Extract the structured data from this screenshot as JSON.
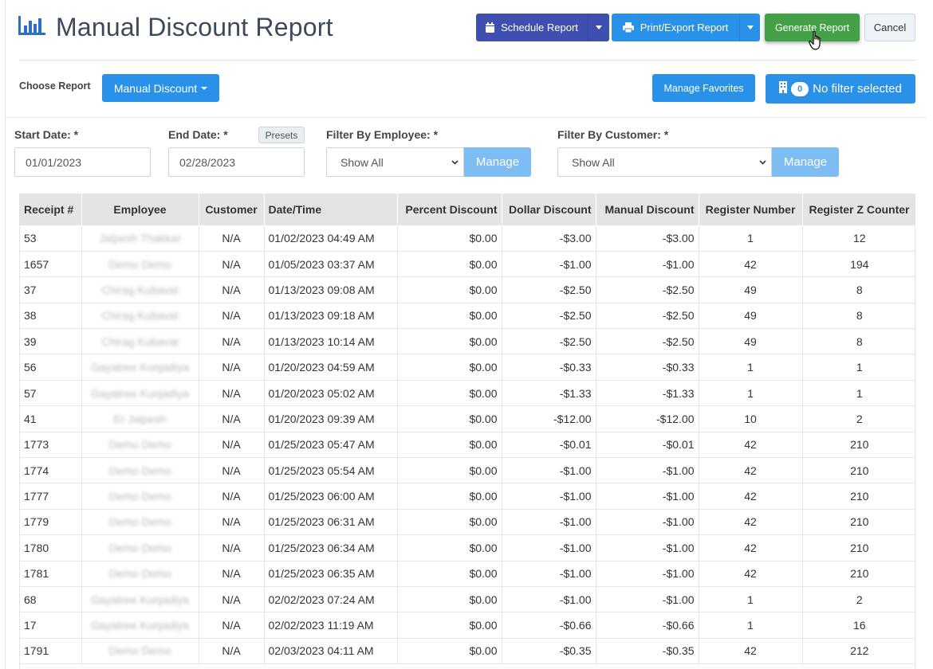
{
  "header": {
    "title": "Manual Discount Report",
    "schedule_label": "Schedule Report",
    "print_label": "Print/Export Report",
    "generate_label": "Generate Report",
    "cancel_label": "Cancel"
  },
  "report_bar": {
    "choose_label": "Choose Report",
    "selected_report": "Manual Discount",
    "favorites_label": "Manage Favorites",
    "filter_count": "0",
    "filter_label": "No filter selected"
  },
  "filters": {
    "start_date_label": "Start Date: *",
    "start_date_value": "01/01/2023",
    "end_date_label": "End Date: *",
    "end_date_value": "02/28/2023",
    "presets_label": "Presets",
    "employee_label": "Filter By Employee: *",
    "employee_value": "Show All",
    "customer_label": "Filter By Customer: *",
    "customer_value": "Show All",
    "manage_label": "Manage"
  },
  "table": {
    "columns": [
      "Receipt #",
      "Employee",
      "Customer",
      "Date/Time",
      "Percent Discount",
      "Dollar Discount",
      "Manual Discount",
      "Register Number",
      "Register Z Counter"
    ],
    "rows": [
      [
        "53",
        "Jalpesh Thakkar",
        "N/A",
        "01/02/2023 04:49 AM",
        "$0.00",
        "-$3.00",
        "-$3.00",
        "1",
        "12"
      ],
      [
        "1657",
        "Demo Demo",
        "N/A",
        "01/05/2023 03:37 AM",
        "$0.00",
        "-$1.00",
        "-$1.00",
        "42",
        "194"
      ],
      [
        "37",
        "Chirag Kubavat",
        "N/A",
        "01/13/2023 09:08 AM",
        "$0.00",
        "-$2.50",
        "-$2.50",
        "49",
        "8"
      ],
      [
        "38",
        "Chirag Kubavat",
        "N/A",
        "01/13/2023 09:18 AM",
        "$0.00",
        "-$2.50",
        "-$2.50",
        "49",
        "8"
      ],
      [
        "39",
        "Chirag Kubavat",
        "N/A",
        "01/13/2023 10:14 AM",
        "$0.00",
        "-$2.50",
        "-$2.50",
        "49",
        "8"
      ],
      [
        "56",
        "Gayatree Kunjadiya",
        "N/A",
        "01/20/2023 04:59 AM",
        "$0.00",
        "-$0.33",
        "-$0.33",
        "1",
        "1"
      ],
      [
        "57",
        "Gayatree Kunjadiya",
        "N/A",
        "01/20/2023 05:02 AM",
        "$0.00",
        "-$1.33",
        "-$1.33",
        "1",
        "1"
      ],
      [
        "41",
        "Er Jalpesh",
        "N/A",
        "01/20/2023 09:39 AM",
        "$0.00",
        "-$12.00",
        "-$12.00",
        "10",
        "2"
      ],
      [
        "1773",
        "Demo Demo",
        "N/A",
        "01/25/2023 05:47 AM",
        "$0.00",
        "-$0.01",
        "-$0.01",
        "42",
        "210"
      ],
      [
        "1774",
        "Demo Demo",
        "N/A",
        "01/25/2023 05:54 AM",
        "$0.00",
        "-$1.00",
        "-$1.00",
        "42",
        "210"
      ],
      [
        "1777",
        "Demo Demo",
        "N/A",
        "01/25/2023 06:00 AM",
        "$0.00",
        "-$1.00",
        "-$1.00",
        "42",
        "210"
      ],
      [
        "1779",
        "Demo Demo",
        "N/A",
        "01/25/2023 06:31 AM",
        "$0.00",
        "-$1.00",
        "-$1.00",
        "42",
        "210"
      ],
      [
        "1780",
        "Demo Demo",
        "N/A",
        "01/25/2023 06:34 AM",
        "$0.00",
        "-$1.00",
        "-$1.00",
        "42",
        "210"
      ],
      [
        "1781",
        "Demo Demo",
        "N/A",
        "01/25/2023 06:35 AM",
        "$0.00",
        "-$1.00",
        "-$1.00",
        "42",
        "210"
      ],
      [
        "68",
        "Gayatree Kunjadiya",
        "N/A",
        "02/02/2023 07:24 AM",
        "$0.00",
        "-$1.00",
        "-$1.00",
        "1",
        "2"
      ],
      [
        "17",
        "Gayatree Kunjadiya",
        "N/A",
        "02/02/2023 11:19 AM",
        "$0.00",
        "-$0.66",
        "-$0.66",
        "1",
        "16"
      ],
      [
        "1791",
        "Demo Demo",
        "N/A",
        "02/03/2023 04:11 AM",
        "$0.00",
        "-$0.35",
        "-$0.35",
        "42",
        "212"
      ]
    ]
  },
  "colors": {
    "schedule": "#3f4fb0",
    "primary": "#2a91e8",
    "generate": "#43a047",
    "manage": "#7dbdf3"
  }
}
